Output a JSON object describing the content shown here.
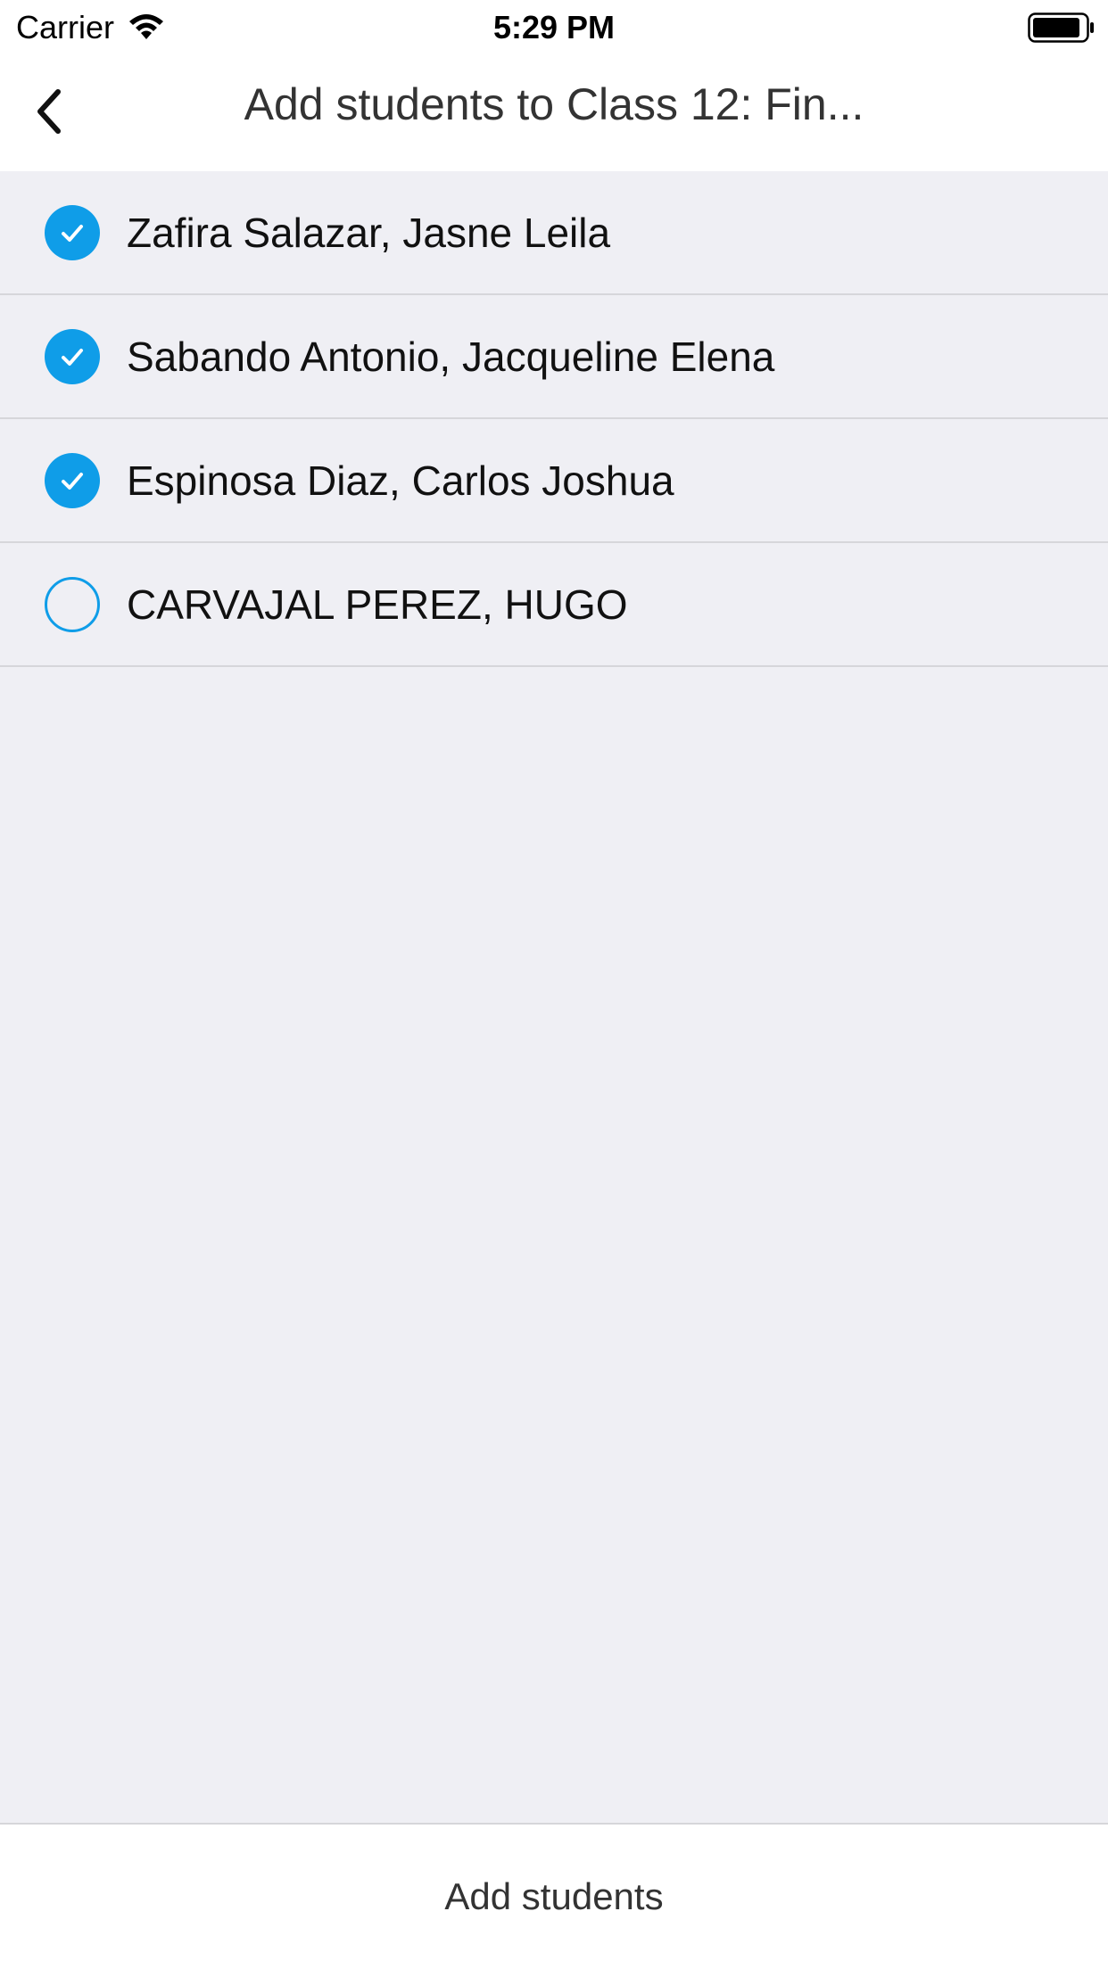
{
  "status_bar": {
    "carrier": "Carrier",
    "time": "5:29 PM",
    "icons": [
      "wifi-icon",
      "battery-icon"
    ]
  },
  "nav": {
    "back_icon": "chevron-left-icon",
    "title": "Add students to Class 12: Fin..."
  },
  "students": [
    {
      "name": "Zafira Salazar, Jasne Leila",
      "selected": true
    },
    {
      "name": "Sabando Antonio, Jacqueline Elena",
      "selected": true
    },
    {
      "name": "Espinosa Diaz, Carlos Joshua",
      "selected": true
    },
    {
      "name": "CARVAJAL PEREZ, HUGO",
      "selected": false
    }
  ],
  "footer": {
    "add_label": "Add students"
  },
  "colors": {
    "accent": "#0f9de8",
    "background": "#efeff4",
    "bar": "#ffffff",
    "separator": "#d6d6da"
  }
}
